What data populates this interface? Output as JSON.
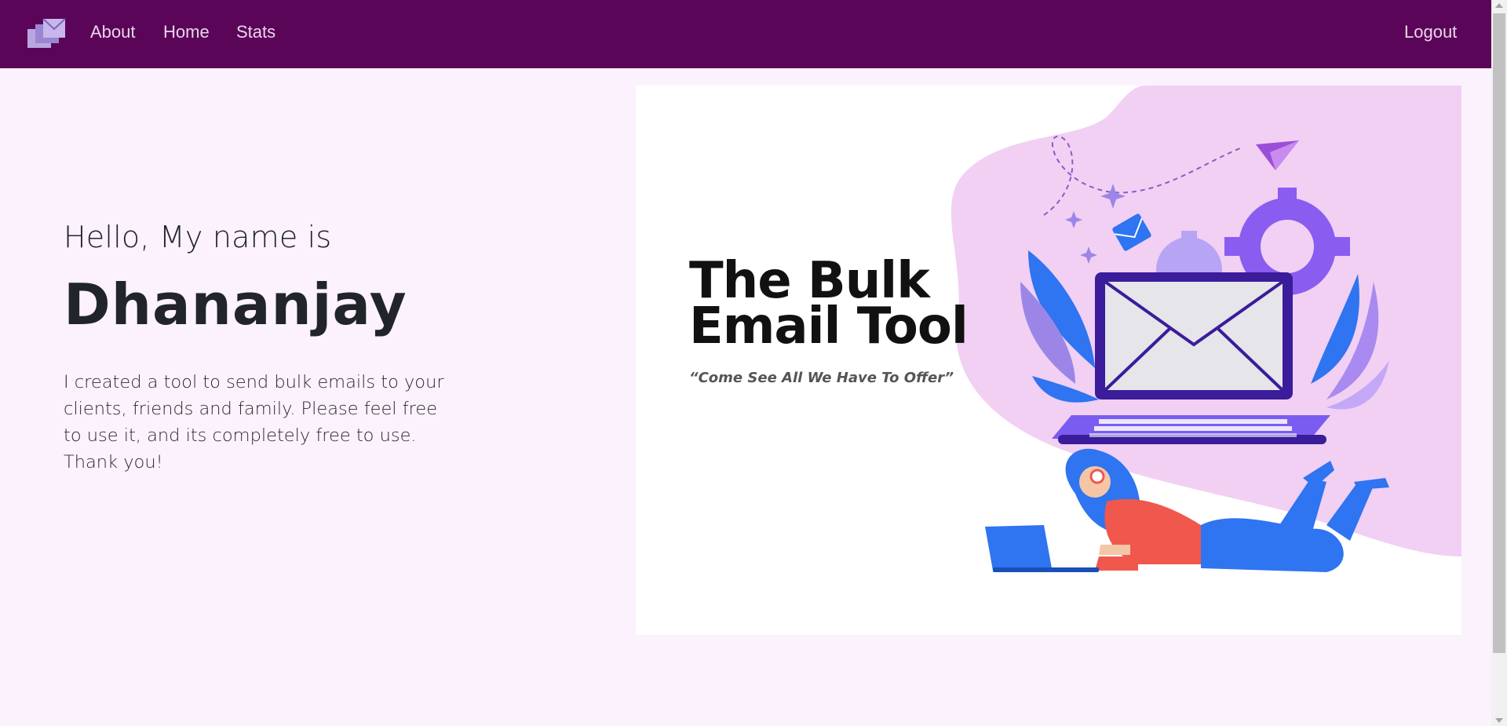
{
  "nav": {
    "about": "About",
    "home": "Home",
    "stats": "Stats",
    "logout": "Logout"
  },
  "intro": {
    "greeting": "Hello, My name is",
    "name": "Dhananjay",
    "description": "I created a tool to send bulk emails to your clients, friends and family. Please feel free to use it, and its completely free to use. Thank you!"
  },
  "hero": {
    "title_line1": "The Bulk",
    "title_line2": "Email Tool",
    "tagline": "“Come See All We Have To Offer”"
  },
  "colors": {
    "navbar": "#5b0558",
    "page_background": "#fbf2fd",
    "blob": "#f1d0f4",
    "laptop_purple": "#3b1c9a",
    "accent_blue": "#2f74f0",
    "shirt_red": "#f0574d"
  },
  "icons": [
    "logo-icon",
    "mail-envelope-icon",
    "paper-plane-icon",
    "gear-icon",
    "laptop-icon"
  ]
}
